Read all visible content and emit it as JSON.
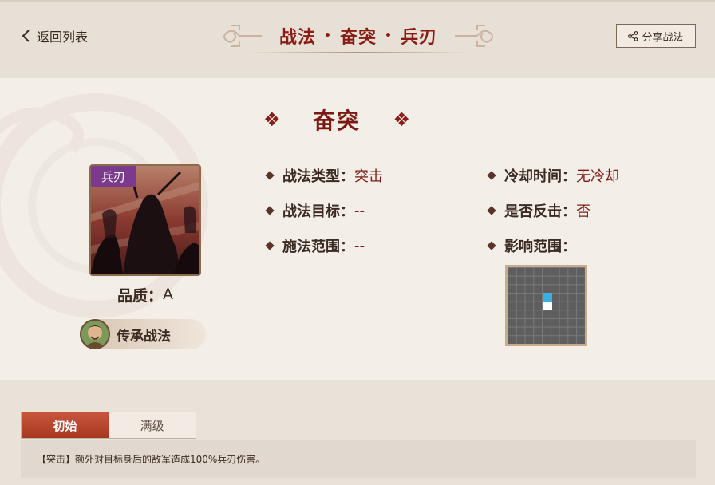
{
  "header": {
    "back_label": "返回列表",
    "title_parts": [
      "战法",
      "奋突",
      "兵刃"
    ],
    "title_sep": "•",
    "share_label": "分享战法"
  },
  "skill": {
    "name": "奋突",
    "ornament": "❖",
    "type_tag": "兵刃",
    "quality_label": "品质：",
    "quality_value": "A",
    "inherit_label": "传承战法"
  },
  "attributes": {
    "left": [
      {
        "key": "战法类型：",
        "value": "突击"
      },
      {
        "key": "战法目标：",
        "value": "--"
      },
      {
        "key": "施法范围：",
        "value": "--"
      }
    ],
    "right": [
      {
        "key": "冷却时间：",
        "value": "无冷却"
      },
      {
        "key": "是否反击：",
        "value": "否"
      },
      {
        "key": "影响范围：",
        "value": ""
      }
    ]
  },
  "tabs": [
    {
      "label": "初始",
      "active": true
    },
    {
      "label": "满级",
      "active": false
    }
  ],
  "description": "【突击】额外对目标身后的敌军造成100%兵刃伤害。",
  "colors": {
    "accent": "#8a1c14",
    "tab_active": "#b84429",
    "type_tag": "#7b3a8e",
    "grid_target": "#3bb0e0",
    "grid_self": "#ffffff"
  }
}
